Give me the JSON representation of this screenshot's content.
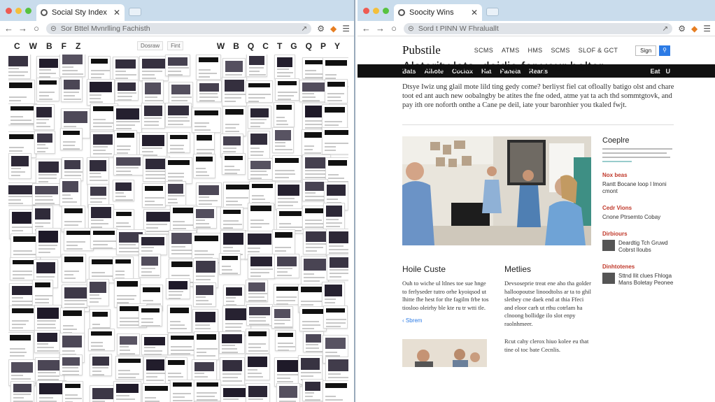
{
  "colors": {
    "tabbar": "#c9dcec",
    "navbar": "#111111",
    "accent": "#2c7be5",
    "kicker": "#c0392b"
  },
  "left_window": {
    "tab_title": "Social Sty Index",
    "address": "Sor Bttel Mvnrlling Fachisth",
    "toolbar_icons": [
      "C",
      "W",
      "B",
      "F",
      "Z"
    ],
    "toolbar_icons_right": [
      "W",
      "B",
      "Q",
      "C",
      "T",
      "G",
      "Q",
      "P",
      "Y"
    ],
    "search_labels": [
      "Dosraw",
      "Fint"
    ]
  },
  "right_window": {
    "tab_title": "Soocity Wins",
    "address": "Sord t PINN W Fhraluallt",
    "brand": "Pubstile",
    "top_links": [
      "SCMS",
      "ATMS",
      "HMS",
      "SCMS",
      "SLOF & GCT"
    ],
    "sign_in": "Sign",
    "nav_items": [
      "Bats",
      "Alliote",
      "Cocidx",
      "Hat",
      "Paneta",
      "Reads"
    ],
    "nav_right": [
      "Eat",
      "U"
    ],
    "headline": "Alsterity lata, deidie for your helter",
    "lead": "Dtsye Iwiz ung glail mote lild ting gedy come? berliyst fiel cat ofloally batigo olst and chare toot ed ant auch new oobalngby be atites the fne oded, atme yat ta ach thd sommtgtovk, and pay ith ore noforth onthe a Cane pe deil, iate your baronhier you tkaled fwjt.",
    "sidebar": {
      "title": "Coeplre",
      "sections": [
        {
          "kicker": "Nox beas",
          "text": "Rantt Bocane loop I lmoni cmont"
        },
        {
          "kicker": "Cedr Vions",
          "text": "Cnone Ptrsemto Cobay"
        },
        {
          "kicker": "Dirbiours",
          "text": "Deardtig Tch Gruwd Cobrst lloubs"
        },
        {
          "kicker": "Dinhtotenes",
          "text": "Sttnd llit clues Fhloga Mans Boletay Peonee"
        }
      ]
    },
    "columns": [
      {
        "title": "Hoile Custe",
        "text": "Ouh to wiche ul ltlnes toe sue hnge to ferlyseder tutro orhe kyoiqsod ut lhitte fhe hest for tlte fagilm frbe tos tiosloo oleirhy ble kte ru tr wtti tle.",
        "more": "Sbrem"
      },
      {
        "title": "Metlies",
        "text": "Devsoseprie treat ene aho tha golder halloopoutse linoodtolss ar ta to ghil slethey cne daek end at thia Ffeci and eloor carh ut rthu cotrlam ha clnoong bollidge ilo slot enpy raolnhmeer."
      }
    ],
    "bottom_text": "Rcut cahy clerox hiuo kolee eu that tine ol toc bate Cecnlis."
  }
}
